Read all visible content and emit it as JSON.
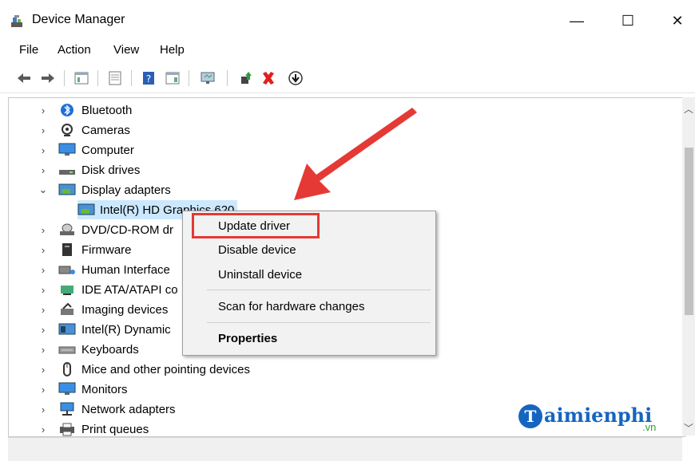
{
  "window": {
    "title": "Device Manager",
    "minimize_glyph": "—",
    "maximize_glyph": "☐",
    "close_glyph": "✕"
  },
  "menu": [
    "File",
    "Action",
    "View",
    "Help"
  ],
  "toolbar_icons": [
    "back-arrow-icon",
    "forward-arrow-icon",
    "show-hide-tree-icon",
    "properties-icon",
    "help-icon",
    "view-icon",
    "monitor-scan-icon",
    "enable-device-icon",
    "uninstall-x-icon",
    "download-driver-icon"
  ],
  "tree": [
    {
      "label": "Bluetooth",
      "icon": "bluetooth-icon",
      "chev": "›"
    },
    {
      "label": "Cameras",
      "icon": "camera-icon",
      "chev": "›"
    },
    {
      "label": "Computer",
      "icon": "computer-icon",
      "chev": "›"
    },
    {
      "label": "Disk drives",
      "icon": "disk-drive-icon",
      "chev": "›"
    },
    {
      "label": "Display adapters",
      "icon": "display-adapter-icon",
      "chev": "⌄"
    },
    {
      "label": "Intel(R) HD Graphics 620",
      "icon": "display-adapter-icon",
      "chev": ""
    },
    {
      "label": "DVD/CD-ROM dr",
      "icon": "dvd-drive-icon",
      "chev": "›"
    },
    {
      "label": "Firmware",
      "icon": "firmware-icon",
      "chev": "›"
    },
    {
      "label": "Human Interface",
      "icon": "hid-icon",
      "chev": "›"
    },
    {
      "label": "IDE ATA/ATAPI co",
      "icon": "ide-controller-icon",
      "chev": "›"
    },
    {
      "label": "Imaging devices",
      "icon": "imaging-device-icon",
      "chev": "›"
    },
    {
      "label": "Intel(R) Dynamic",
      "icon": "intel-dynamic-icon",
      "chev": "›"
    },
    {
      "label": "Keyboards",
      "icon": "keyboard-icon",
      "chev": "›"
    },
    {
      "label": "Mice and other pointing devices",
      "icon": "mouse-icon",
      "chev": "›"
    },
    {
      "label": "Monitors",
      "icon": "monitor-icon",
      "chev": "›"
    },
    {
      "label": "Network adapters",
      "icon": "network-adapter-icon",
      "chev": "›"
    },
    {
      "label": "Print queues",
      "icon": "printer-icon",
      "chev": "›"
    }
  ],
  "context_menu": {
    "update_driver": "Update driver",
    "disable_device": "Disable device",
    "uninstall_device": "Uninstall device",
    "scan": "Scan for hardware changes",
    "properties": "Properties"
  },
  "watermark": {
    "text": "aimienphi",
    "suffix": ".vn",
    "letter": "T"
  },
  "colors": {
    "selection": "#cce8ff",
    "highlight_box": "#e53935",
    "arrow": "#e53935",
    "logo_blue": "#1565c0"
  }
}
